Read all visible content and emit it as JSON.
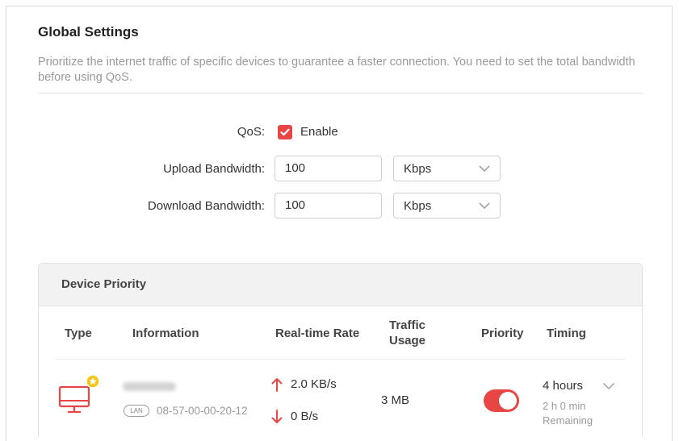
{
  "section": {
    "title": "Global Settings",
    "description": "Prioritize the internet traffic of specific devices to guarantee a faster connection. You need to set the total bandwidth before using QoS."
  },
  "qos": {
    "label": "QoS:",
    "enable_label": "Enable",
    "enabled": true
  },
  "upload": {
    "label": "Upload Bandwidth:",
    "value": "100",
    "unit": "Kbps"
  },
  "download": {
    "label": "Download Bandwidth:",
    "value": "100",
    "unit": "Kbps"
  },
  "device_priority": {
    "title": "Device Priority",
    "columns": {
      "type": "Type",
      "information": "Information",
      "realtime_rate": "Real-time Rate",
      "traffic_usage": "Traffic Usage",
      "priority": "Priority",
      "timing": "Timing"
    },
    "rows": [
      {
        "device_type_icon": "desktop-monitor-icon",
        "connection": "LAN",
        "mac": "08-57-00-00-20-12",
        "upload_rate": "2.0 KB/s",
        "download_rate": "0 B/s",
        "traffic": "3 MB",
        "priority_on": true,
        "timing": "4 hours",
        "remaining_time": "2 h 0 min",
        "remaining_label": "Remaining"
      }
    ]
  },
  "colors": {
    "accent": "#e84545",
    "muted_text": "#9a9a9a"
  }
}
